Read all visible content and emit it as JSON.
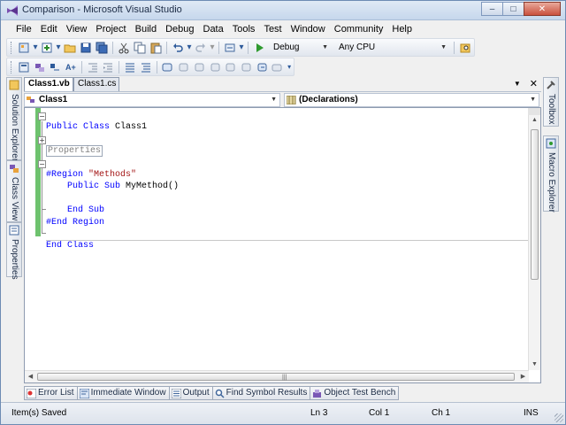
{
  "window": {
    "title": "Comparison - Microsoft Visual Studio",
    "controls": {
      "minimize": "–",
      "maximize": "□",
      "close": "✕"
    }
  },
  "menu": [
    "File",
    "Edit",
    "View",
    "Project",
    "Build",
    "Debug",
    "Data",
    "Tools",
    "Test",
    "Window",
    "Community",
    "Help"
  ],
  "toolbar": {
    "config": "Debug",
    "platform": "Any CPU"
  },
  "left_panels": [
    "Solution Explorer",
    "Class View",
    "Properties"
  ],
  "right_panels": [
    "Toolbox",
    "Macro Explorer"
  ],
  "doc_tabs": [
    {
      "label": "Class1.vb",
      "active": true
    },
    {
      "label": "Class1.cs",
      "active": false
    }
  ],
  "doc_strip_buttons": {
    "dropdown": "▼",
    "close": "✕"
  },
  "navigation": {
    "type_combo": "Class1",
    "member_combo": "(Declarations)"
  },
  "code": {
    "line1_kw": "Public Class",
    "line1_name": "Class1",
    "line3_collapsed": "Properties",
    "line5_kw": "#Region",
    "line5_str": "\"Methods\"",
    "line6_kw": "Public Sub",
    "line6_name": "MyMethod()",
    "line8_kw": "End Sub",
    "line9_kw": "#End Region",
    "line11_kw": "End Class"
  },
  "bottom_tabs": [
    "Error List",
    "Immediate Window",
    "Output",
    "Find Symbol Results",
    "Object Test Bench"
  ],
  "status": {
    "message": "Item(s) Saved",
    "line": "Ln 3",
    "col": "Col 1",
    "ch": "Ch 1",
    "mode": "INS"
  }
}
